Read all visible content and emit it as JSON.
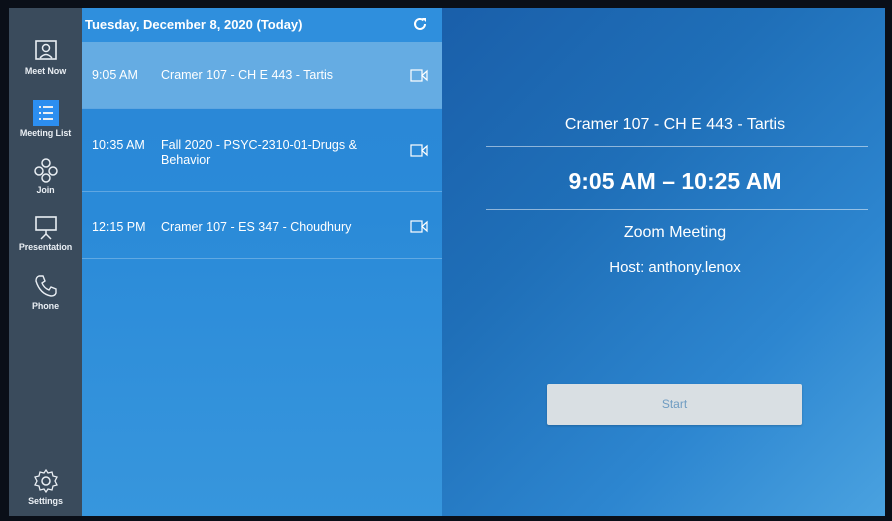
{
  "sidebar": {
    "items": [
      {
        "label": "Meet Now",
        "icon": "meet-now-icon"
      },
      {
        "label": "Meeting List",
        "icon": "meeting-list-icon"
      },
      {
        "label": "Join",
        "icon": "join-icon"
      },
      {
        "label": "Presentation",
        "icon": "presentation-icon"
      },
      {
        "label": "Phone",
        "icon": "phone-icon"
      },
      {
        "label": "Settings",
        "icon": "gear-icon"
      }
    ],
    "active": "Meeting List"
  },
  "list": {
    "date": "Tuesday, December 8, 2020 (Today)",
    "meetings": [
      {
        "time": "9:05 AM",
        "title": "Cramer 107 - CH E 443 - Tartis"
      },
      {
        "time": "10:35 AM",
        "title": "Fall 2020 - PSYC-2310-01-Drugs & Behavior"
      },
      {
        "time": "12:15 PM",
        "title": "Cramer 107 - ES 347 - Choudhury"
      }
    ]
  },
  "detail": {
    "title": "Cramer 107 - CH E 443 - Tartis",
    "time_range": "9:05 AM – 10:25 AM",
    "meeting_type": "Zoom Meeting",
    "host": "Host: anthony.lenox",
    "start_label": "Start"
  },
  "colors": {
    "rail": "#3a4b5c",
    "list_bg": "#2a86d6",
    "selected_row": "#65ace3",
    "accent": "#2c8ef0",
    "button_bg": "#d9dfe3"
  }
}
